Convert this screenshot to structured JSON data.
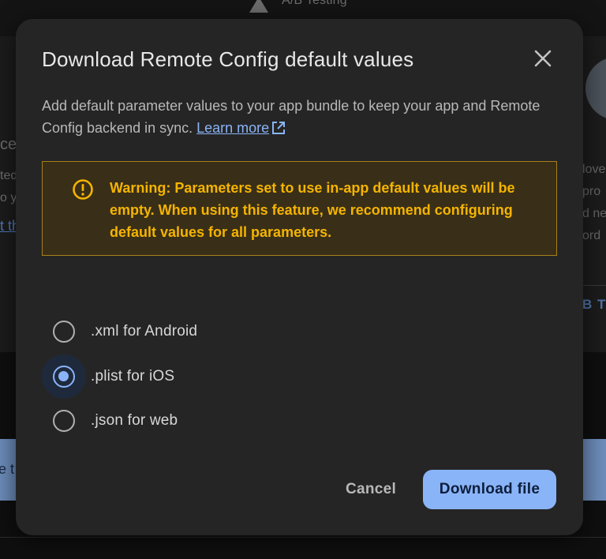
{
  "background": {
    "top_bar_label": "A/B Testing",
    "left_fragments": [
      "ce",
      "ted",
      "o y",
      "t th"
    ],
    "right_fragments": [
      "love",
      "pro",
      "d ne",
      "ord"
    ],
    "right_tab_fragment": "B T",
    "banner_fragment": "e t"
  },
  "dialog": {
    "title": "Download Remote Config default values",
    "description": "Add default parameter values to your app bundle to keep your app and Remote Config backend in sync.",
    "learn_more": "Learn more",
    "warning": "Warning: Parameters set to use in-app default values will be empty. When using this feature, we recommend configuring default values for all parameters.",
    "options": [
      {
        "label": ".xml for Android",
        "selected": false
      },
      {
        "label": ".plist for iOS",
        "selected": true
      },
      {
        "label": ".json for web",
        "selected": false
      }
    ],
    "cancel_label": "Cancel",
    "download_label": "Download file"
  },
  "colors": {
    "accent": "#8ab4f8",
    "warning_text": "#f5b400",
    "warning_bg": "#392f18",
    "dialog_bg": "#252525"
  }
}
